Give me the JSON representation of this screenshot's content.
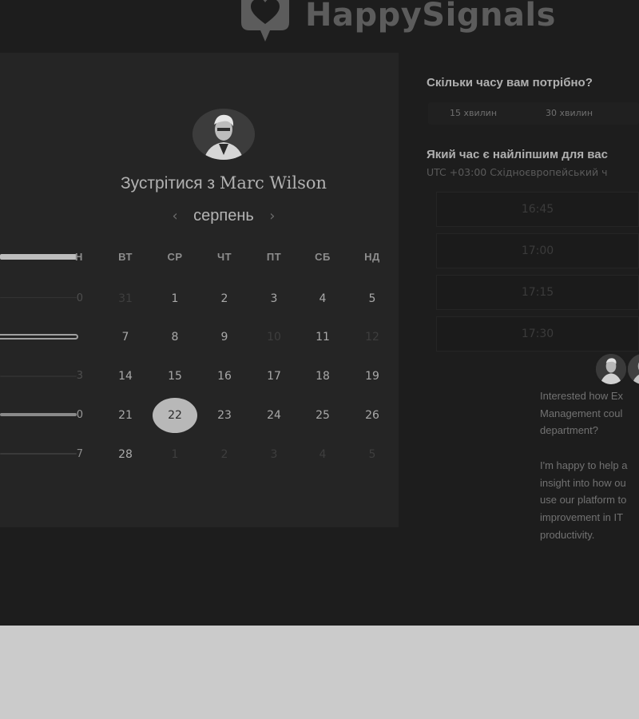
{
  "brand": {
    "name": "HappySignals"
  },
  "left": {
    "title_prefix": "Зустрітися з",
    "host_name": "Marc Wilson",
    "month": "серпень",
    "prev_icon": "chevron-left-icon",
    "next_icon": "chevron-right-icon",
    "weekdays": [
      "Н",
      "ВТ",
      "СР",
      "ЧТ",
      "ПТ",
      "СБ",
      "НД"
    ],
    "rows": [
      {
        "edge": "0",
        "days": [
          "31",
          "1",
          "2",
          "3",
          "4",
          "5"
        ],
        "muted": [
          true,
          false,
          false,
          false,
          false,
          false
        ]
      },
      {
        "edge": "",
        "days": [
          "7",
          "8",
          "9",
          "10",
          "11",
          "12"
        ],
        "muted": [
          false,
          false,
          false,
          true,
          false,
          true
        ]
      },
      {
        "edge": "3",
        "days": [
          "14",
          "15",
          "16",
          "17",
          "18",
          "19"
        ],
        "muted": [
          false,
          false,
          false,
          false,
          false,
          false
        ]
      },
      {
        "edge": "0",
        "days": [
          "21",
          "22",
          "23",
          "24",
          "25",
          "26"
        ],
        "muted": [
          false,
          false,
          false,
          false,
          false,
          false
        ]
      },
      {
        "edge": "7",
        "days": [
          "28",
          "1",
          "2",
          "3",
          "4",
          "5"
        ],
        "muted": [
          false,
          true,
          true,
          true,
          true,
          true
        ]
      }
    ],
    "selected_day": "22"
  },
  "right": {
    "duration_question": "Скільки часу вам потрібно?",
    "durations": [
      "15 хвилин",
      "30 хвилин"
    ],
    "time_question": "Який час є найліпшим для вас",
    "timezone": "UTC +03:00 Східноєвропейський ч",
    "slots": [
      "16:45",
      "17:00",
      "17:15",
      "17:30"
    ],
    "blurb_lines_1": [
      "Interested how Ex",
      "Management coul",
      "department?"
    ],
    "blurb_lines_2": [
      "I'm happy to help a",
      "insight into how ou",
      "use our platform to",
      "improvement in IT",
      "productivity."
    ]
  },
  "colors": {
    "page_bg": "#1d1d1d",
    "panel_bg": "#252525",
    "selected_day": "#b8b8b8",
    "below_fold": "#cbcbcb"
  }
}
